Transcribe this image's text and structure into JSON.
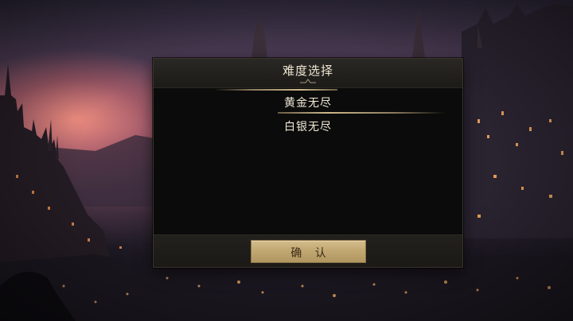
{
  "dialog": {
    "title": "难度选择",
    "options": [
      {
        "label": "黄金无尽",
        "selected": true
      },
      {
        "label": "白银无尽",
        "selected": false
      }
    ],
    "confirm_label": "确 认"
  },
  "colors": {
    "accent_gold": "#c2a873",
    "panel_bg": "#0b0b0b",
    "text_light": "#f2ead8"
  }
}
